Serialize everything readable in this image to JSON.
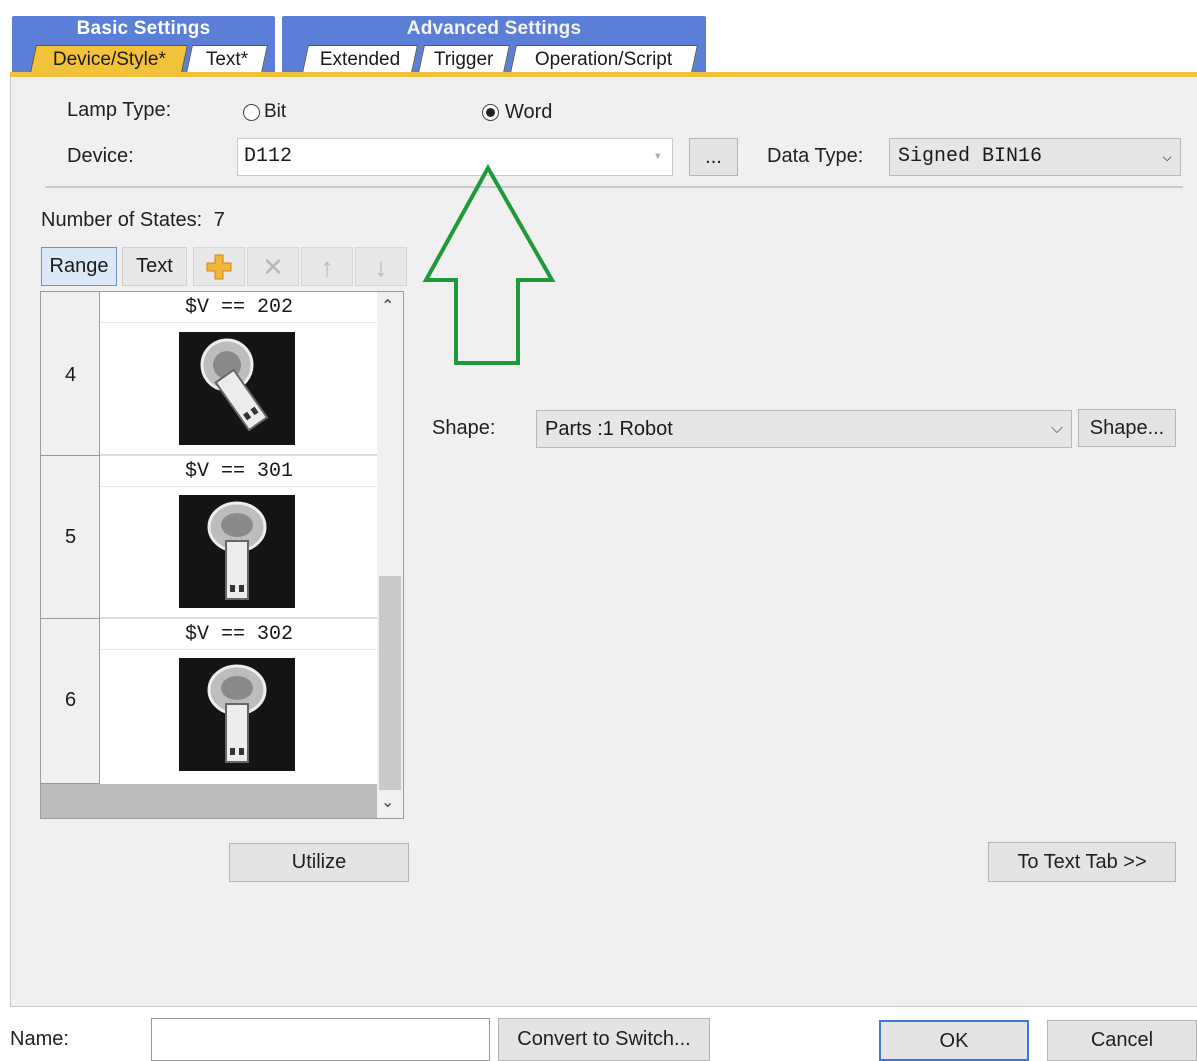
{
  "tabs": {
    "basic_group": "Basic Settings",
    "advanced_group": "Advanced Settings",
    "items": [
      "Device/Style*",
      "Text*",
      "Extended",
      "Trigger",
      "Operation/Script"
    ]
  },
  "lamp_type": {
    "label": "Lamp Type:",
    "options": [
      "Bit",
      "Word"
    ],
    "selected": "Word"
  },
  "device": {
    "label": "Device:",
    "value": "D112",
    "browse_label": "..."
  },
  "data_type": {
    "label": "Data Type:",
    "value": "Signed BIN16"
  },
  "states": {
    "label": "Number of States:",
    "count": "7"
  },
  "toolbar": {
    "range_label": "Range",
    "text_label": "Text"
  },
  "state_rows": [
    {
      "number": "4",
      "condition": "$V == 202"
    },
    {
      "number": "5",
      "condition": "$V == 301"
    },
    {
      "number": "6",
      "condition": "$V == 302"
    }
  ],
  "shape": {
    "label": "Shape:",
    "value": "Parts :1 Robot",
    "button": "Shape..."
  },
  "utilize_label": "Utilize",
  "to_text_tab_label": "To Text Tab >>",
  "footer": {
    "name_label": "Name:",
    "name_value": "",
    "convert_label": "Convert to Switch...",
    "ok_label": "OK",
    "cancel_label": "Cancel"
  },
  "colors": {
    "tab_group": "#5b7fd6",
    "active_tab": "#f2c23a",
    "annotation_arrow": "#1f9a3a"
  }
}
